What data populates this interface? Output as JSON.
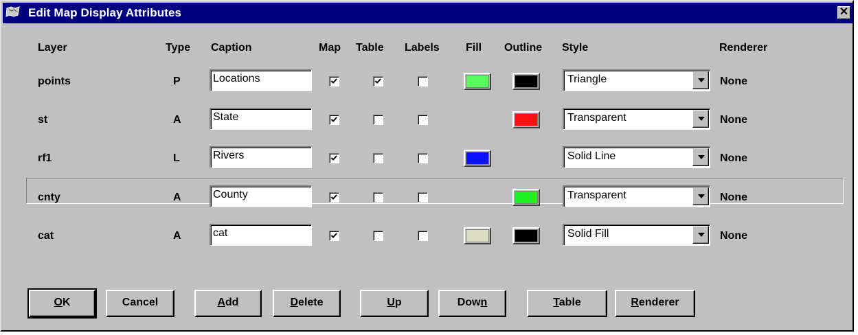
{
  "window": {
    "title": "Edit Map Display Attributes",
    "close_glyph": "✕"
  },
  "headers": {
    "layer": "Layer",
    "type": "Type",
    "caption": "Caption",
    "map": "Map",
    "table": "Table",
    "labels": "Labels",
    "fill": "Fill",
    "outline": "Outline",
    "style": "Style",
    "renderer": "Renderer"
  },
  "rows": [
    {
      "layer": "points",
      "type": "P",
      "caption": "Locations",
      "map": true,
      "table": true,
      "labels": false,
      "fill": "#5cfb5c",
      "outline": "#000000",
      "style": "Triangle",
      "renderer": "None",
      "selected": false
    },
    {
      "layer": "st",
      "type": "A",
      "caption": "State",
      "map": true,
      "table": false,
      "labels": false,
      "fill": null,
      "outline": "#ff1010",
      "style": "Transparent",
      "renderer": "None",
      "selected": false
    },
    {
      "layer": "rf1",
      "type": "L",
      "caption": "Rivers",
      "map": true,
      "table": false,
      "labels": false,
      "fill": "#0a12ff",
      "outline": null,
      "style": "Solid Line",
      "renderer": "None",
      "selected": false
    },
    {
      "layer": "cnty",
      "type": "A",
      "caption": "County",
      "map": true,
      "table": false,
      "labels": false,
      "fill": null,
      "outline": "#1ef21e",
      "style": "Transparent",
      "renderer": "None",
      "selected": true
    },
    {
      "layer": "cat",
      "type": "A",
      "caption": "cat",
      "map": true,
      "table": false,
      "labels": false,
      "fill": "#dcdcc0",
      "outline": "#000000",
      "style": "Solid Fill",
      "renderer": "None",
      "selected": false
    }
  ],
  "buttons": {
    "ok": {
      "mnemonic": "O",
      "rest": "K"
    },
    "cancel": {
      "label": "Cancel"
    },
    "add": {
      "mnemonic": "A",
      "rest": "dd"
    },
    "delete": {
      "mnemonic": "D",
      "rest": "elete"
    },
    "up": {
      "mnemonic": "U",
      "rest": "p"
    },
    "down": {
      "pre": "Dow",
      "mnemonic": "n"
    },
    "table": {
      "mnemonic": "T",
      "rest": "able"
    },
    "renderer": {
      "mnemonic": "R",
      "rest": "enderer"
    }
  }
}
